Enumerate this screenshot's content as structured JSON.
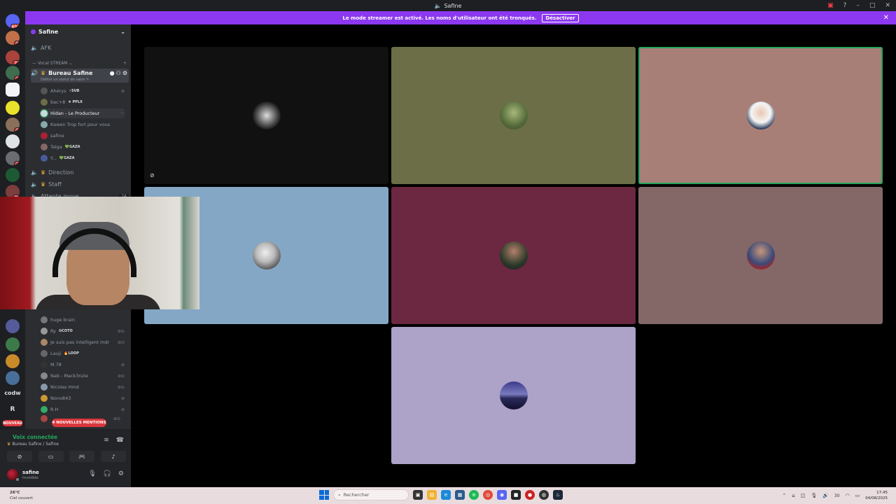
{
  "window": {
    "title": "Safine"
  },
  "banner": {
    "message": "Le mode streamer est activé. Les noms d'utilisateur ont été tronqués.",
    "button": "Désactiver",
    "close": "✕"
  },
  "rail": {
    "badges": {
      "top": "691",
      "s1": "8",
      "s2": "21",
      "s3": "3",
      "s4": "8",
      "s5": "2",
      "s6": "21"
    },
    "codw": "codw",
    "r": "R",
    "new": "NOUVEAU"
  },
  "sidebar": {
    "server_name": "Safine",
    "afk": "AFK",
    "category": "— Vocal STREAM ⌄",
    "active_channel": "Bureau Safine",
    "status_hint": "Définir un statut de salon ✎",
    "users": [
      {
        "name": "Ahérys",
        "tag": "⚡SUB"
      },
      {
        "name": "bac+8",
        "tag": "❖ PPLX"
      },
      {
        "name": "Hidan - Le Producteur",
        "tag": ""
      },
      {
        "name": "Kawen Trop fort pour vous",
        "tag": ""
      },
      {
        "name": "safine",
        "tag": ""
      },
      {
        "name": "Talga",
        "tag": "💚GAZA"
      },
      {
        "name": "Y...",
        "tag": "💚GAZA"
      }
    ],
    "channels": [
      "Direction",
      "Staff",
      "Attente move"
    ],
    "attente_count": "24",
    "lower_users": [
      {
        "name": "huge brain",
        "tag": ""
      },
      {
        "name": "Ry",
        "tag": "✪COTO"
      },
      {
        "name": "Je suis pas intelligent mdr",
        "tag": ""
      },
      {
        "name": "Lauji",
        "tag": "🔥LOOP"
      },
      {
        "name": "M.78",
        "tag": ""
      },
      {
        "name": "Nab - Mack3nzie",
        "tag": ""
      },
      {
        "name": "Nicolas Hmd",
        "tag": ""
      },
      {
        "name": "Nono843",
        "tag": ""
      },
      {
        "name": "R.H",
        "tag": ""
      }
    ],
    "mentions": "4 NOUVELLES MENTIONS"
  },
  "voice": {
    "title": "Voix connectée",
    "subtitle": "Bureau Safine / Safine"
  },
  "user_panel": {
    "name": "safine",
    "status": "Invisible"
  },
  "taskbar": {
    "weather_temp": "26°C",
    "weather_desc": "Ciel couvert",
    "search": "Rechercher",
    "time": "17:45",
    "date": "04/08/2025",
    "volume": "30"
  },
  "colors": {
    "tile1": "#111111",
    "tile2": "#6c6e48",
    "tile3": "#a77f76",
    "tile4": "#84a7c6",
    "tile5": "#6c2741",
    "tile6": "#846767",
    "tile7": "#ada2c7",
    "accent": "#8b38f0",
    "speaking": "#23a55a"
  }
}
